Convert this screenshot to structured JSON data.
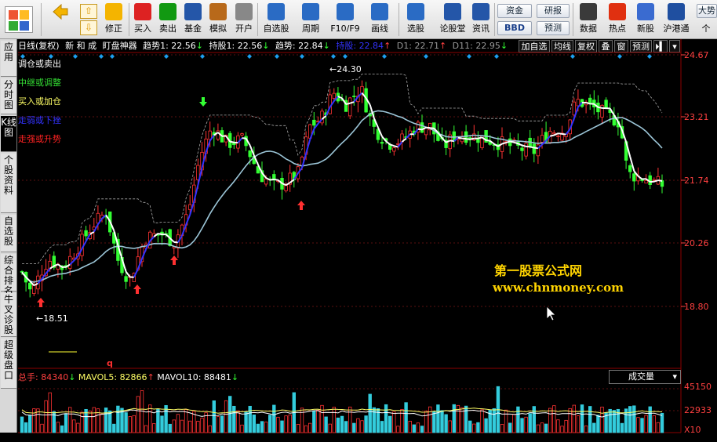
{
  "toolbar": {
    "buttons": [
      {
        "id": "back",
        "label": "",
        "icon": "back-arrow-icon"
      },
      {
        "id": "up",
        "label": "",
        "icon": "up-arrow-icon"
      },
      {
        "id": "down",
        "label": "",
        "icon": "down-arrow-icon"
      },
      {
        "id": "fix",
        "label": "修正",
        "icon": "fix-icon"
      },
      {
        "id": "buy",
        "label": "买入",
        "icon": "buy-icon"
      },
      {
        "id": "sell",
        "label": "卖出",
        "icon": "sell-icon"
      },
      {
        "id": "fund",
        "label": "基金",
        "icon": "fund-icon"
      },
      {
        "id": "sim",
        "label": "模拟",
        "icon": "hammer-icon"
      },
      {
        "id": "open",
        "label": "开户",
        "icon": "lock-icon"
      },
      {
        "id": "watchlist",
        "label": "自选股",
        "icon": "star-folder-icon"
      },
      {
        "id": "period",
        "label": "周期",
        "icon": "clock-icon"
      },
      {
        "id": "f10",
        "label": "F10/F9",
        "icon": "f10-icon"
      },
      {
        "id": "draw",
        "label": "画线",
        "icon": "pencil-icon"
      },
      {
        "id": "pick",
        "label": "选股",
        "icon": "screen-icon"
      },
      {
        "id": "forum",
        "label": "论股堂",
        "icon": "forum-icon"
      },
      {
        "id": "news",
        "label": "资讯",
        "icon": "news-icon"
      },
      {
        "id": "data",
        "label": "数据",
        "icon": "pe-icon"
      },
      {
        "id": "hot",
        "label": "热点",
        "icon": "hot-icon"
      },
      {
        "id": "ipo",
        "label": "新股",
        "icon": "ipo-icon"
      },
      {
        "id": "hk",
        "label": "沪港通",
        "icon": "hk-icon"
      },
      {
        "id": "more",
        "label": "个",
        "icon": ""
      }
    ],
    "small": {
      "funds": "资金",
      "bbd": "BBD",
      "report": "研报",
      "forecast": "预测",
      "big": "大势"
    }
  },
  "left_tabs": [
    "应用",
    "分时图",
    "K线图",
    "个股资料",
    "自选股",
    "综合排名",
    "牛叉诊股",
    "超级盘口"
  ],
  "active_tab": "K线图",
  "header": {
    "period": "日线(复权)",
    "stock": "新 和 成",
    "indicator": "盯盘神器",
    "trend1_label": "趋势1: ",
    "trend1_val": "22.56",
    "hold1_label": "持股1: ",
    "hold1_val": "22.56",
    "trend_label": "趋势: ",
    "trend_val": "22.84",
    "hold_label": "持股: ",
    "hold_val": "22.84",
    "d1_label": "D1: ",
    "d1_val": "22.71",
    "d11_label": "D11: ",
    "d11_val": "22.95"
  },
  "header_buttons": [
    "加自选",
    "均线",
    "复权",
    "叠",
    "窗",
    "预测",
    "⏵▍",
    "▾"
  ],
  "legend": [
    {
      "text": "调仓或卖出",
      "color": "#ffffff"
    },
    {
      "text": "中继或调整",
      "color": "#33dd33"
    },
    {
      "text": "买入或加仓",
      "color": "#ffff66"
    },
    {
      "text": "走弱或下挫",
      "color": "#3333ff"
    },
    {
      "text": "走强或升势",
      "color": "#ff2222"
    }
  ],
  "price_axis": [
    "24.67",
    "23.21",
    "21.74",
    "20.26",
    "18.80"
  ],
  "price_axis_color": "#ff4040",
  "annotations": {
    "high": "24.30",
    "low": "18.51",
    "marker": "q"
  },
  "watermark": {
    "cn": "第一股票公式网",
    "url": "www.chnmoney.com"
  },
  "volume": {
    "label": "总手: ",
    "val": "84340",
    "mavol5_label": "MAVOL5: ",
    "mavol5_val": "82866",
    "mavol10_label": "MAVOL10: ",
    "mavol10_val": "88481",
    "axis": [
      "45150",
      "22933",
      "X10"
    ],
    "dropdown": "成交量"
  },
  "colors": {
    "up": "#ff3333",
    "down": "#33ff33",
    "vol_up": "#ff3333",
    "vol_down": "#33ccdd",
    "ma": "#9cc6d8",
    "trend": "#ffffff",
    "blue": "#3333ff"
  }
}
